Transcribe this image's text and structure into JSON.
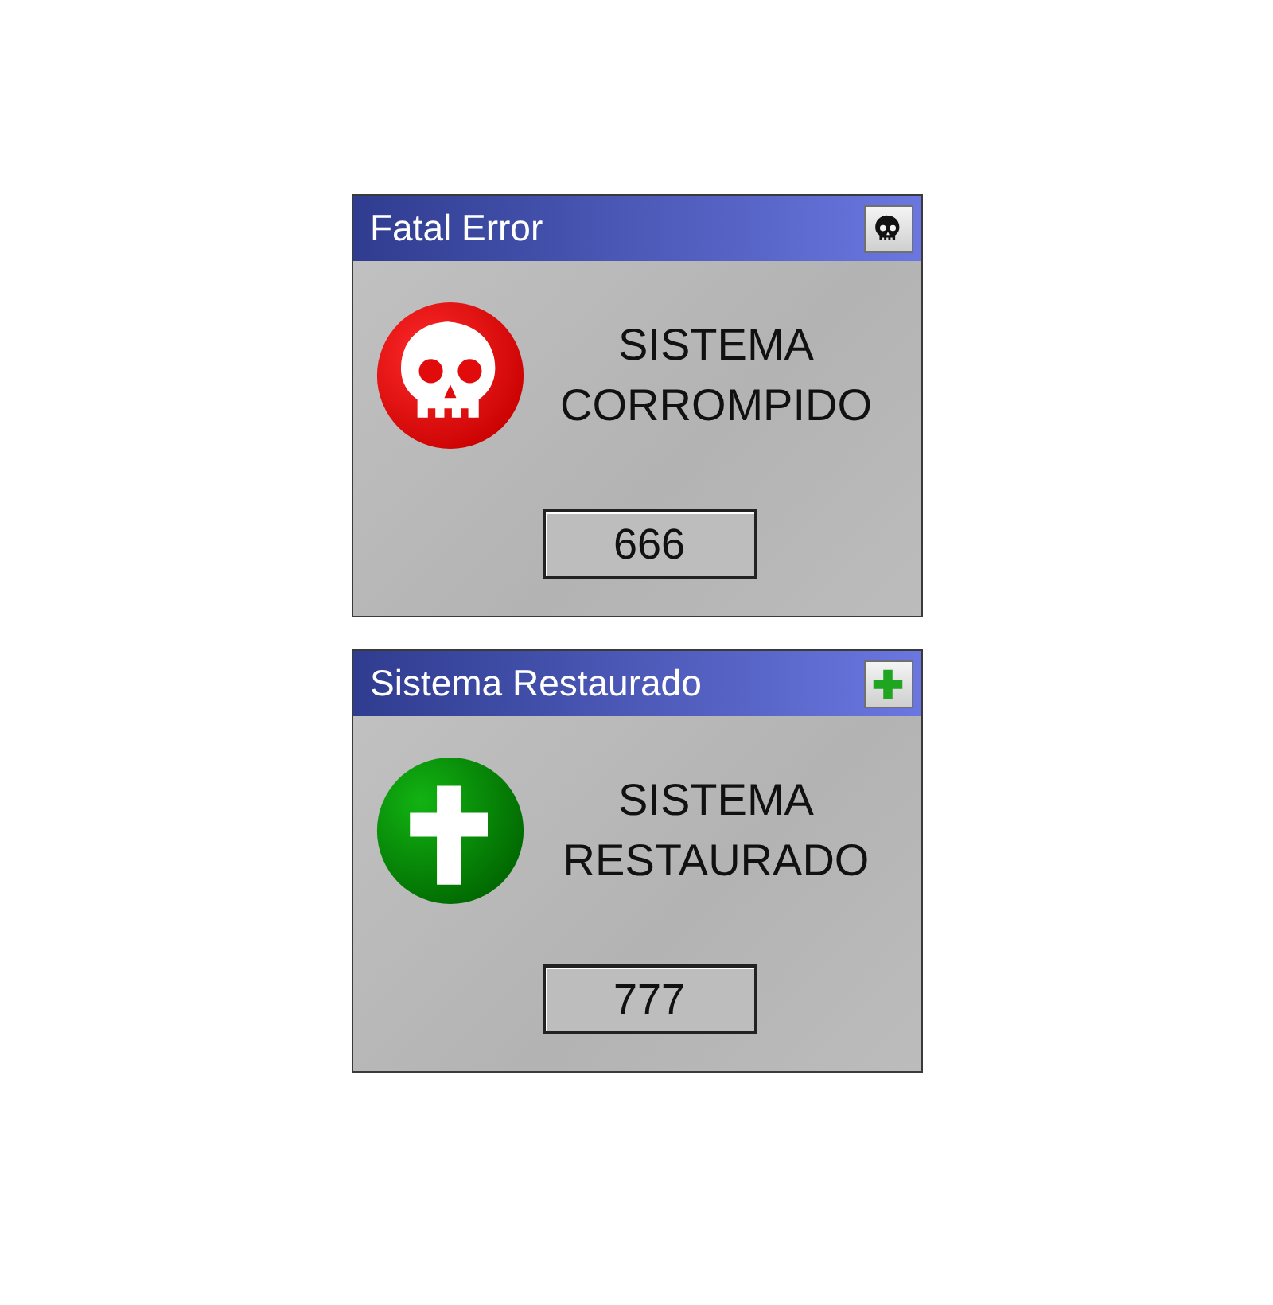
{
  "dialogs": [
    {
      "kind": "error",
      "title": "Fatal Error",
      "message_lines": [
        "SISTEMA",
        "CORROMPIDO"
      ],
      "button": "666"
    },
    {
      "kind": "restored",
      "title": "Sistema Restaurado",
      "message_lines": [
        "SISTEMA",
        "RESTAURADO"
      ],
      "button": "777"
    }
  ]
}
